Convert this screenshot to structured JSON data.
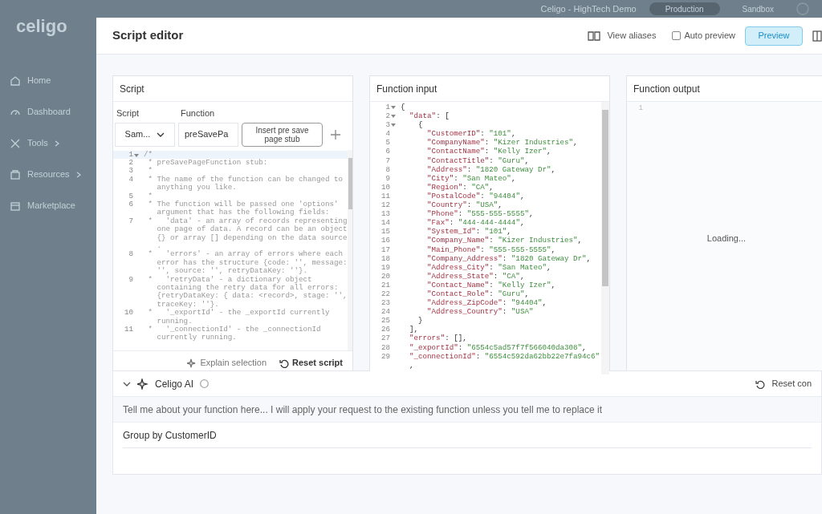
{
  "app": {
    "logo": "celigo",
    "account": "Celigo - HighTech Demo",
    "environments": [
      {
        "label": "Production",
        "selected": true
      },
      {
        "label": "Sandbox",
        "selected": false
      }
    ]
  },
  "sidebar": {
    "items": [
      {
        "label": "Home",
        "has_submenu": false
      },
      {
        "label": "Dashboard",
        "has_submenu": false
      },
      {
        "label": "Tools",
        "has_submenu": true
      },
      {
        "label": "Resources",
        "has_submenu": true
      },
      {
        "label": "Marketplace",
        "has_submenu": false
      }
    ]
  },
  "dialog": {
    "title": "Script editor",
    "view_aliases": "View aliases",
    "auto_preview": {
      "label": "Auto preview",
      "checked": false
    },
    "preview_button": "Preview"
  },
  "script_panel": {
    "title": "Script",
    "script_label": "Script",
    "script_value": "Sam...",
    "function_label": "Function",
    "function_value": "preSavePa",
    "insert_button": "Insert pre save page stub",
    "lines": [
      {
        "number": "1",
        "foldable": true,
        "rows": [
          "/*"
        ]
      },
      {
        "number": "2",
        "foldable": false,
        "rows": [
          " * preSavePageFunction stub:"
        ]
      },
      {
        "number": "3",
        "foldable": false,
        "rows": [
          " *"
        ]
      },
      {
        "number": "4",
        "foldable": false,
        "rows": [
          " * The name of the function can be changed to",
          "   anything you like."
        ]
      },
      {
        "number": "5",
        "foldable": false,
        "rows": [
          " *"
        ]
      },
      {
        "number": "6",
        "foldable": false,
        "rows": [
          " * The function will be passed one 'options'",
          "   argument that has the following fields:"
        ]
      },
      {
        "number": "7",
        "foldable": false,
        "rows": [
          " *   'data' - an array of records representing",
          "   one page of data. A record can be an object",
          "   {} or array [] depending on the data source",
          "   ."
        ]
      },
      {
        "number": "8",
        "foldable": false,
        "rows": [
          " *   'errors' - an array of errors where each",
          "   error has the structure {code: '', message:",
          "   '', source: '', retryDataKey: ''}."
        ]
      },
      {
        "number": "9",
        "foldable": false,
        "rows": [
          " *   'retryData' - a dictionary object",
          "   containing the retry data for all errors:",
          "   {retryDataKey: { data: <record>, stage: '',",
          "   traceKey: ''}."
        ]
      },
      {
        "number": "10",
        "foldable": false,
        "rows": [
          " *   '_exportId' - the _exportId currently",
          "   running."
        ]
      },
      {
        "number": "11",
        "foldable": false,
        "rows": [
          " *   '_connectionId' - the _connectionId",
          "   currently running."
        ]
      }
    ],
    "explain_button": "Explain selection",
    "reset_button": "Reset script"
  },
  "input_panel": {
    "title": "Function input",
    "lines": [
      {
        "number": "1",
        "foldable": true,
        "rows": [
          "{"
        ]
      },
      {
        "number": "2",
        "foldable": true,
        "rows": [
          "  \"data\": ["
        ]
      },
      {
        "number": "3",
        "foldable": true,
        "rows": [
          "    {"
        ]
      },
      {
        "number": "4",
        "foldable": false,
        "rows": [
          "      \"CustomerID\": \"101\","
        ]
      },
      {
        "number": "5",
        "foldable": false,
        "rows": [
          "      \"CompanyName\": \"Kizer Industries\","
        ]
      },
      {
        "number": "6",
        "foldable": false,
        "rows": [
          "      \"ContactName\": \"Kelly Izer\","
        ]
      },
      {
        "number": "7",
        "foldable": false,
        "rows": [
          "      \"ContactTitle\": \"Guru\","
        ]
      },
      {
        "number": "8",
        "foldable": false,
        "rows": [
          "      \"Address\": \"1820 Gateway Dr\","
        ]
      },
      {
        "number": "9",
        "foldable": false,
        "rows": [
          "      \"City\": \"San Mateo\","
        ]
      },
      {
        "number": "10",
        "foldable": false,
        "rows": [
          "      \"Region\": \"CA\","
        ]
      },
      {
        "number": "11",
        "foldable": false,
        "rows": [
          "      \"PostalCode\": \"94404\","
        ]
      },
      {
        "number": "12",
        "foldable": false,
        "rows": [
          "      \"Country\": \"USA\","
        ]
      },
      {
        "number": "13",
        "foldable": false,
        "rows": [
          "      \"Phone\": \"555-555-5555\","
        ]
      },
      {
        "number": "14",
        "foldable": false,
        "rows": [
          "      \"Fax\": \"444-444-4444\","
        ]
      },
      {
        "number": "15",
        "foldable": false,
        "rows": [
          "      \"System_Id\": \"101\","
        ]
      },
      {
        "number": "16",
        "foldable": false,
        "rows": [
          "      \"Company_Name\": \"Kizer Industries\","
        ]
      },
      {
        "number": "17",
        "foldable": false,
        "rows": [
          "      \"Main_Phone\": \"555-555-5555\","
        ]
      },
      {
        "number": "18",
        "foldable": false,
        "rows": [
          "      \"Company_Address\": \"1820 Gateway Dr\","
        ]
      },
      {
        "number": "19",
        "foldable": false,
        "rows": [
          "      \"Address_City\": \"San Mateo\","
        ]
      },
      {
        "number": "20",
        "foldable": false,
        "rows": [
          "      \"Address_State\": \"CA\","
        ]
      },
      {
        "number": "21",
        "foldable": false,
        "rows": [
          "      \"Contact_Name\": \"Kelly Izer\","
        ]
      },
      {
        "number": "22",
        "foldable": false,
        "rows": [
          "      \"Contact_Role\": \"Guru\","
        ]
      },
      {
        "number": "23",
        "foldable": false,
        "rows": [
          "      \"Address_ZipCode\": \"94404\","
        ]
      },
      {
        "number": "24",
        "foldable": false,
        "rows": [
          "      \"Address_Country\": \"USA\""
        ]
      },
      {
        "number": "25",
        "foldable": false,
        "rows": [
          "    }"
        ]
      },
      {
        "number": "26",
        "foldable": false,
        "rows": [
          "  ],"
        ]
      },
      {
        "number": "27",
        "foldable": false,
        "rows": [
          "  \"errors\": [],"
        ]
      },
      {
        "number": "28",
        "foldable": false,
        "rows": [
          "  \"_exportId\": \"6554c5ad57f7f566040da308\","
        ]
      },
      {
        "number": "29",
        "foldable": false,
        "rows": [
          "  \"_connectionId\": \"6554c592da62bb22e7fa94c6\"",
          "  ,"
        ]
      }
    ]
  },
  "output_panel": {
    "title": "Function output",
    "line_number": "1",
    "status": "Loading..."
  },
  "ai_panel": {
    "title": "Celigo AI",
    "expanded": true,
    "reset_button": "Reset con",
    "description": "Tell me about your function here... I will apply your request to the existing function unless you tell me to replace it",
    "prompt": "Group by CustomerID"
  }
}
